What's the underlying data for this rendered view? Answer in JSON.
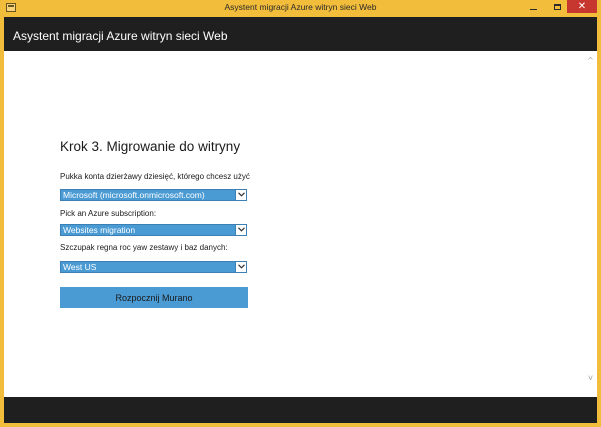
{
  "window": {
    "title": "Asystent migracji Azure witryn sieci Web",
    "controls": {
      "minimize_icon": "minimize-icon",
      "maximize_icon": "maximize-icon",
      "close_glyph": "✕"
    }
  },
  "header": {
    "app_title": "Asystent migracji Azure witryn sieci Web"
  },
  "form": {
    "heading": "Krok 3. Migrowanie do witryny",
    "tenant_label": "Pukka konta dzierżawy dziesięć, którego chcesz użyć",
    "tenant_value": "Microsoft (microsoft.onmicrosoft.com)",
    "subscription_label": "Pick an Azure subscription:",
    "subscription_value": "Websites migration",
    "region_label": "Szczupak regna roc yaw zestawy i baz danych:",
    "region_value": "West US",
    "start_button": "Rozpocznij Murano"
  },
  "scrollbar": {
    "up_glyph": "^",
    "down_glyph": "v"
  },
  "colors": {
    "title_bar": "#f2bd3b",
    "header_bg": "#1f1f1f",
    "accent": "#4a9ad4",
    "close_button": "#c7372f"
  }
}
